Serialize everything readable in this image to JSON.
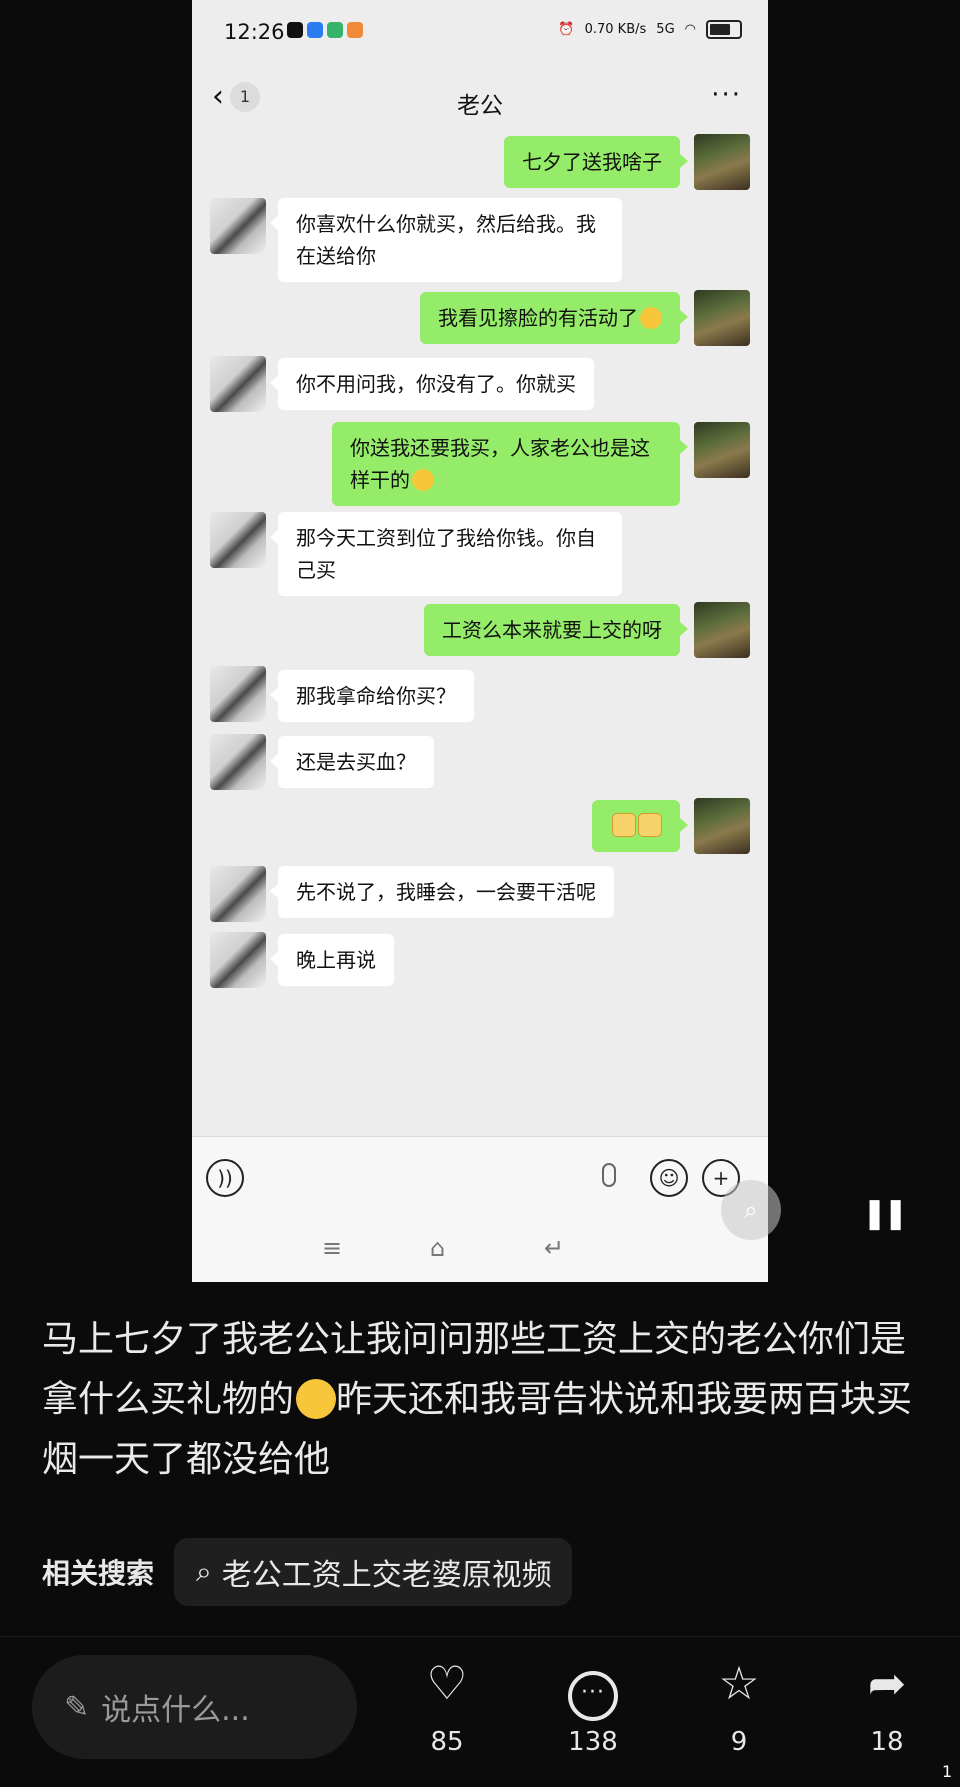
{
  "phone": {
    "status": {
      "time": "12:26",
      "net": "0.70 KB/s",
      "signal": "5G"
    },
    "nav": {
      "back_count": "1",
      "title": "老公",
      "more": "···"
    },
    "messages": [
      {
        "side": "right",
        "text": "七夕了送我啥子"
      },
      {
        "side": "left",
        "text": "你喜欢什么你就买，然后给我。我在送给你"
      },
      {
        "side": "right",
        "text": "我看见擦脸的有活动了",
        "emoji": "laugh-cry"
      },
      {
        "side": "left",
        "text": "你不用问我，你没有了。你就买"
      },
      {
        "side": "right",
        "text": "你送我还要我买，人家老公也是这样干的",
        "emoji": "sly"
      },
      {
        "side": "left",
        "text": "那今天工资到位了我给你钱。你自己买"
      },
      {
        "side": "right",
        "text": "工资么本来就要上交的呀"
      },
      {
        "side": "left",
        "text": "那我拿命给你买？"
      },
      {
        "side": "left",
        "text": "还是去买血？"
      },
      {
        "side": "right",
        "text": "",
        "emoji": "money-face x2"
      },
      {
        "side": "left",
        "text": "先不说了，我睡会，一会要干活呢"
      },
      {
        "side": "left",
        "text": "晚上再说"
      }
    ]
  },
  "post": {
    "caption": "马上七夕了我老公让我问问那些工资上交的老公你们是拿什么买礼物的",
    "caption_tail": "昨天还和我哥告状说和我要两百块买烟一天了都没给他",
    "related_label": "相关搜索",
    "related_query": "老公工资上交老婆原视频"
  },
  "bottom": {
    "comment_placeholder": "说点什么...",
    "likes": "85",
    "comments": "138",
    "favorites": "9",
    "shares": "18",
    "edge": "1"
  },
  "colors": {
    "bubble_right": "#95ec69",
    "bubble_left": "#ffffff",
    "chat_bg": "#ededed",
    "page_bg": "#0b0b0b"
  }
}
